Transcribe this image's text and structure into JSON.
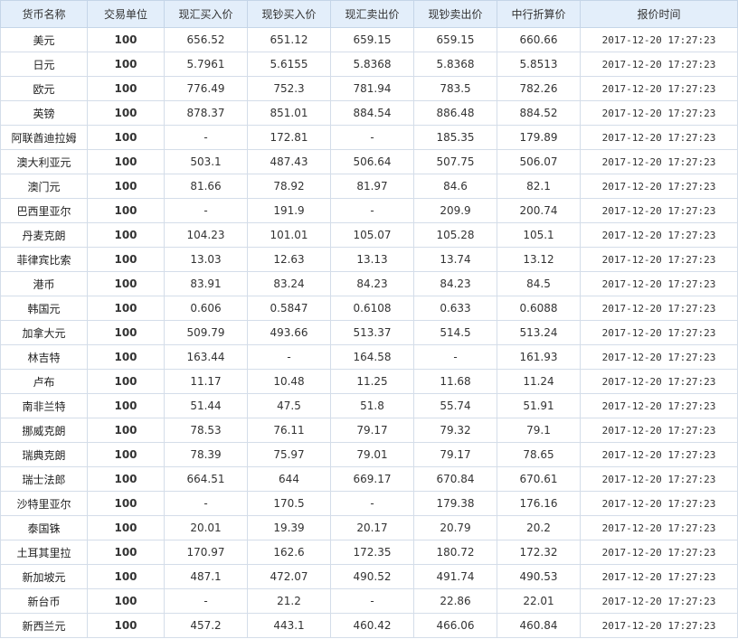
{
  "columns": [
    "货币名称",
    "交易单位",
    "现汇买入价",
    "现钞买入价",
    "现汇卖出价",
    "现钞卖出价",
    "中行折算价",
    "报价时间"
  ],
  "rows": [
    {
      "name": "美元",
      "unit": "100",
      "xhmr": "656.52",
      "xcmr": "651.12",
      "xhmc": "659.15",
      "xcmc": "659.15",
      "zhzs": "660.66",
      "time": "2017-12-20 17:27:23"
    },
    {
      "name": "日元",
      "unit": "100",
      "xhmr": "5.7961",
      "xcmr": "5.6155",
      "xhmc": "5.8368",
      "xcmc": "5.8368",
      "zhzs": "5.8513",
      "time": "2017-12-20 17:27:23"
    },
    {
      "name": "欧元",
      "unit": "100",
      "xhmr": "776.49",
      "xcmr": "752.3",
      "xhmc": "781.94",
      "xcmc": "783.5",
      "zhzs": "782.26",
      "time": "2017-12-20 17:27:23"
    },
    {
      "name": "英镑",
      "unit": "100",
      "xhmr": "878.37",
      "xcmr": "851.01",
      "xhmc": "884.54",
      "xcmc": "886.48",
      "zhzs": "884.52",
      "time": "2017-12-20 17:27:23"
    },
    {
      "name": "阿联酋迪拉姆",
      "unit": "100",
      "xhmr": "-",
      "xcmr": "172.81",
      "xhmc": "-",
      "xcmc": "185.35",
      "zhzs": "179.89",
      "time": "2017-12-20 17:27:23"
    },
    {
      "name": "澳大利亚元",
      "unit": "100",
      "xhmr": "503.1",
      "xcmr": "487.43",
      "xhmc": "506.64",
      "xcmc": "507.75",
      "zhzs": "506.07",
      "time": "2017-12-20 17:27:23"
    },
    {
      "name": "澳门元",
      "unit": "100",
      "xhmr": "81.66",
      "xcmr": "78.92",
      "xhmc": "81.97",
      "xcmc": "84.6",
      "zhzs": "82.1",
      "time": "2017-12-20 17:27:23"
    },
    {
      "name": "巴西里亚尔",
      "unit": "100",
      "xhmr": "-",
      "xcmr": "191.9",
      "xhmc": "-",
      "xcmc": "209.9",
      "zhzs": "200.74",
      "time": "2017-12-20 17:27:23"
    },
    {
      "name": "丹麦克朗",
      "unit": "100",
      "xhmr": "104.23",
      "xcmr": "101.01",
      "xhmc": "105.07",
      "xcmc": "105.28",
      "zhzs": "105.1",
      "time": "2017-12-20 17:27:23"
    },
    {
      "name": "菲律宾比索",
      "unit": "100",
      "xhmr": "13.03",
      "xcmr": "12.63",
      "xhmc": "13.13",
      "xcmc": "13.74",
      "zhzs": "13.12",
      "time": "2017-12-20 17:27:23"
    },
    {
      "name": "港币",
      "unit": "100",
      "xhmr": "83.91",
      "xcmr": "83.24",
      "xhmc": "84.23",
      "xcmc": "84.23",
      "zhzs": "84.5",
      "time": "2017-12-20 17:27:23"
    },
    {
      "name": "韩国元",
      "unit": "100",
      "xhmr": "0.606",
      "xcmr": "0.5847",
      "xhmc": "0.6108",
      "xcmc": "0.633",
      "zhzs": "0.6088",
      "time": "2017-12-20 17:27:23"
    },
    {
      "name": "加拿大元",
      "unit": "100",
      "xhmr": "509.79",
      "xcmr": "493.66",
      "xhmc": "513.37",
      "xcmc": "514.5",
      "zhzs": "513.24",
      "time": "2017-12-20 17:27:23"
    },
    {
      "name": "林吉特",
      "unit": "100",
      "xhmr": "163.44",
      "xcmr": "-",
      "xhmc": "164.58",
      "xcmc": "-",
      "zhzs": "161.93",
      "time": "2017-12-20 17:27:23"
    },
    {
      "name": "卢布",
      "unit": "100",
      "xhmr": "11.17",
      "xcmr": "10.48",
      "xhmc": "11.25",
      "xcmc": "11.68",
      "zhzs": "11.24",
      "time": "2017-12-20 17:27:23"
    },
    {
      "name": "南非兰特",
      "unit": "100",
      "xhmr": "51.44",
      "xcmr": "47.5",
      "xhmc": "51.8",
      "xcmc": "55.74",
      "zhzs": "51.91",
      "time": "2017-12-20 17:27:23"
    },
    {
      "name": "挪威克朗",
      "unit": "100",
      "xhmr": "78.53",
      "xcmr": "76.11",
      "xhmc": "79.17",
      "xcmc": "79.32",
      "zhzs": "79.1",
      "time": "2017-12-20 17:27:23"
    },
    {
      "name": "瑞典克朗",
      "unit": "100",
      "xhmr": "78.39",
      "xcmr": "75.97",
      "xhmc": "79.01",
      "xcmc": "79.17",
      "zhzs": "78.65",
      "time": "2017-12-20 17:27:23"
    },
    {
      "name": "瑞士法郎",
      "unit": "100",
      "xhmr": "664.51",
      "xcmr": "644",
      "xhmc": "669.17",
      "xcmc": "670.84",
      "zhzs": "670.61",
      "time": "2017-12-20 17:27:23"
    },
    {
      "name": "沙特里亚尔",
      "unit": "100",
      "xhmr": "-",
      "xcmr": "170.5",
      "xhmc": "-",
      "xcmc": "179.38",
      "zhzs": "176.16",
      "time": "2017-12-20 17:27:23"
    },
    {
      "name": "泰国铢",
      "unit": "100",
      "xhmr": "20.01",
      "xcmr": "19.39",
      "xhmc": "20.17",
      "xcmc": "20.79",
      "zhzs": "20.2",
      "time": "2017-12-20 17:27:23"
    },
    {
      "name": "土耳其里拉",
      "unit": "100",
      "xhmr": "170.97",
      "xcmr": "162.6",
      "xhmc": "172.35",
      "xcmc": "180.72",
      "zhzs": "172.32",
      "time": "2017-12-20 17:27:23"
    },
    {
      "name": "新加坡元",
      "unit": "100",
      "xhmr": "487.1",
      "xcmr": "472.07",
      "xhmc": "490.52",
      "xcmc": "491.74",
      "zhzs": "490.53",
      "time": "2017-12-20 17:27:23"
    },
    {
      "name": "新台币",
      "unit": "100",
      "xhmr": "-",
      "xcmr": "21.2",
      "xhmc": "-",
      "xcmc": "22.86",
      "zhzs": "22.01",
      "time": "2017-12-20 17:27:23"
    },
    {
      "name": "新西兰元",
      "unit": "100",
      "xhmr": "457.2",
      "xcmr": "443.1",
      "xhmc": "460.42",
      "xcmc": "466.06",
      "zhzs": "460.84",
      "time": "2017-12-20 17:27:23"
    }
  ]
}
